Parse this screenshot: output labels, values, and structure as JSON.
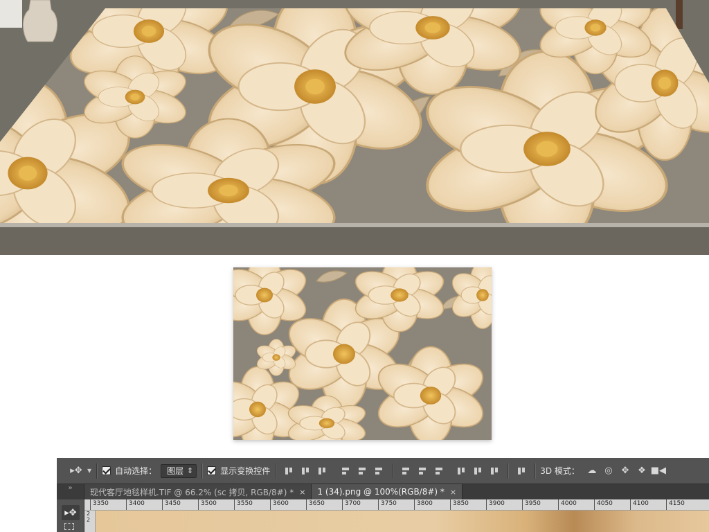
{
  "optionsBar": {
    "autoSelectLabel": "自动选择：",
    "autoSelectTarget": "图层",
    "showTransformLabel": "显示变换控件",
    "mode3dLabel": "3D 模式："
  },
  "tabs": [
    {
      "label": "现代客厅地毯样机.TIF @ 66.2% (sc 拷贝, RGB/8#) *",
      "active": false
    },
    {
      "label": "1 (34).png @ 100%(RGB/8#) *",
      "active": true
    }
  ],
  "rulerMarks": [
    "3350",
    "3400",
    "3450",
    "3500",
    "3550",
    "3600",
    "3650",
    "3700",
    "3750",
    "3800",
    "3850",
    "3900",
    "3950",
    "4000",
    "4050",
    "4100",
    "4150"
  ],
  "verticalRuler": [
    "2",
    "2"
  ],
  "colors": {
    "floral": "#f1dcbc",
    "floralShade": "#d9bd93",
    "background": "#8c857a",
    "gold": "#d9a53c",
    "leaf": "#c7b496",
    "panel": "#535353"
  },
  "icons": {
    "move": "move-tool-icon",
    "close": "close-icon",
    "mode3d": [
      "orbit-3d-icon",
      "roll-3d-icon",
      "pan-3d-icon",
      "slide-3d-icon",
      "video-camera-icon"
    ]
  }
}
